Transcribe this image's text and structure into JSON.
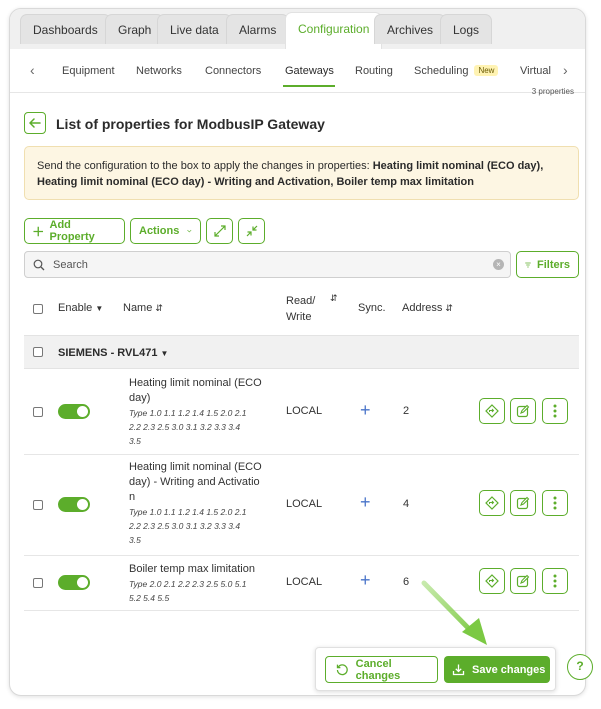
{
  "top_tabs": [
    "Dashboards",
    "Graph",
    "Live data",
    "Alarms",
    "Configuration",
    "Archives",
    "Logs"
  ],
  "active_top_tab": "Configuration",
  "sub_tabs": [
    "Equipment",
    "Networks",
    "Connectors",
    "Gateways",
    "Routing",
    "Scheduling",
    "Virtual"
  ],
  "active_sub_tab": "Gateways",
  "scheduling_badge": "New",
  "property_count": "3 properties",
  "page_title": "List of properties for ModbusIP Gateway",
  "notice": {
    "prefix": "Send the configuration to the box to apply the changes in properties: ",
    "items": "Heating limit nominal (ECO day), Heating limit nominal (ECO day) - Writing and Activation, Boiler temp max limitation"
  },
  "toolbar": {
    "add_property": "Add Property",
    "actions": "Actions",
    "filters": "Filters"
  },
  "search": {
    "placeholder": "Search"
  },
  "table": {
    "headers": {
      "enable": "Enable",
      "name": "Name",
      "read_write_1": "Read/",
      "read_write_2": "Write",
      "sync": "Sync.",
      "address": "Address"
    },
    "group": "SIEMENS - RVL471",
    "rows": [
      {
        "name_1": "Heating limit nominal (ECO",
        "name_2": "day)",
        "type_1": "Type 1.0 1.1 1.2 1.4 1.5 2.0 2.1",
        "type_2": "2.2 2.3 2.5 3.0 3.1 3.2 3.3 3.4",
        "type_3": "3.5",
        "rw": "LOCAL",
        "address": "2",
        "enabled": true
      },
      {
        "name_1": "Heating limit nominal (ECO",
        "name_2": "day) - Writing and Activatio",
        "name_3": "n",
        "type_1": "Type 1.0 1.1 1.2 1.4 1.5 2.0 2.1",
        "type_2": "2.2 2.3 2.5 3.0 3.1 3.2 3.3 3.4",
        "type_3": "3.5",
        "rw": "LOCAL",
        "address": "4",
        "enabled": true
      },
      {
        "name_1": "Boiler temp max limitation",
        "type_1": "Type 2.0 2.1 2.2 2.3 2.5 5.0 5.1",
        "type_2": "5.2 5.4 5.5",
        "rw": "LOCAL",
        "address": "6",
        "enabled": true
      }
    ]
  },
  "footer": {
    "cancel": "Cancel changes",
    "save": "Save changes"
  },
  "colors": {
    "accent": "#5cad2b",
    "notice_bg": "#fdf6e3",
    "sync_plus": "#4a74c9"
  }
}
